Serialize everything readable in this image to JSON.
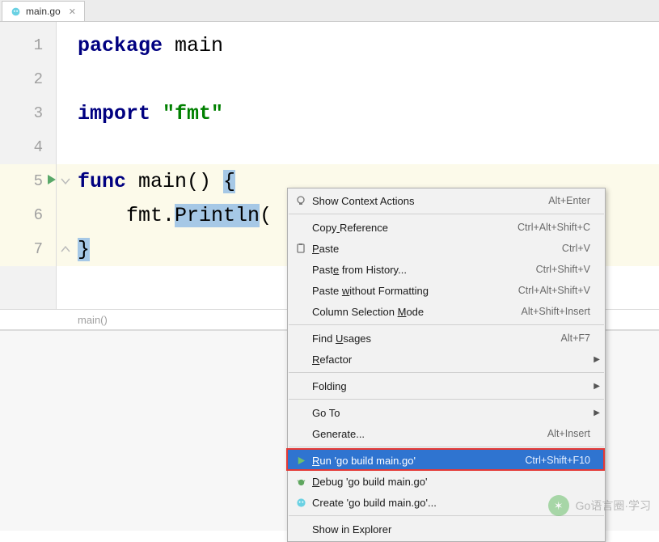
{
  "tab": {
    "label": "main.go"
  },
  "code": {
    "lines": [
      {
        "n": "1",
        "tokens": [
          {
            "t": "package ",
            "c": "kw"
          },
          {
            "t": "main",
            "c": "ident"
          }
        ]
      },
      {
        "n": "2",
        "tokens": []
      },
      {
        "n": "3",
        "tokens": [
          {
            "t": "import ",
            "c": "kw"
          },
          {
            "t": "\"fmt\"",
            "c": "str"
          }
        ]
      },
      {
        "n": "4",
        "tokens": []
      },
      {
        "n": "5",
        "tokens": [
          {
            "t": "func ",
            "c": "kw"
          },
          {
            "t": "main",
            "c": "func-name"
          },
          {
            "t": "() ",
            "c": ""
          },
          {
            "t": "{",
            "c": "sel"
          }
        ],
        "run": true,
        "hl": true,
        "foldOpen": true
      },
      {
        "n": "6",
        "tokens": [
          {
            "t": "    fmt.",
            "c": ""
          },
          {
            "t": "Println",
            "c": "sel"
          },
          {
            "t": "(",
            "c": ""
          }
        ],
        "hl": true
      },
      {
        "n": "7",
        "tokens": [
          {
            "t": "}",
            "c": "sel"
          }
        ],
        "hl": true,
        "foldClose": true
      }
    ]
  },
  "breadcrumb": {
    "text": "main()"
  },
  "menu": {
    "items": [
      {
        "icon": "bulb",
        "label": "Show Context Actions",
        "shortcut": "Alt+Enter"
      },
      {
        "sep": true
      },
      {
        "label": "Copy Reference",
        "u": [
          4
        ],
        "shortcut": "Ctrl+Alt+Shift+C"
      },
      {
        "icon": "paste",
        "label": "Paste",
        "u": [
          0
        ],
        "shortcut": "Ctrl+V"
      },
      {
        "label": "Paste from History...",
        "u": [
          4
        ],
        "shortcut": "Ctrl+Shift+V"
      },
      {
        "label": "Paste without Formatting",
        "u": [
          6
        ],
        "shortcut": "Ctrl+Alt+Shift+V"
      },
      {
        "label": "Column Selection Mode",
        "u": [
          17
        ],
        "shortcut": "Alt+Shift+Insert"
      },
      {
        "sep": true
      },
      {
        "label": "Find Usages",
        "u": [
          5
        ],
        "shortcut": "Alt+F7"
      },
      {
        "label": "Refactor",
        "u": [
          0
        ],
        "sub": true
      },
      {
        "sep": true
      },
      {
        "label": "Folding",
        "sub": true
      },
      {
        "sep": true
      },
      {
        "label": "Go To",
        "sub": true
      },
      {
        "label": "Generate...",
        "shortcut": "Alt+Insert"
      },
      {
        "sep": true
      },
      {
        "icon": "play",
        "label": "Run 'go build main.go'",
        "u": [
          0
        ],
        "shortcut": "Ctrl+Shift+F10",
        "selected": true,
        "redbox": true
      },
      {
        "icon": "bug",
        "label": "Debug 'go build main.go'",
        "u": [
          0
        ]
      },
      {
        "icon": "gopher",
        "label": "Create 'go build main.go'..."
      },
      {
        "sep": true
      },
      {
        "label": "Show in Explorer"
      }
    ]
  },
  "watermark": {
    "text": "Go语言圈·学习"
  }
}
